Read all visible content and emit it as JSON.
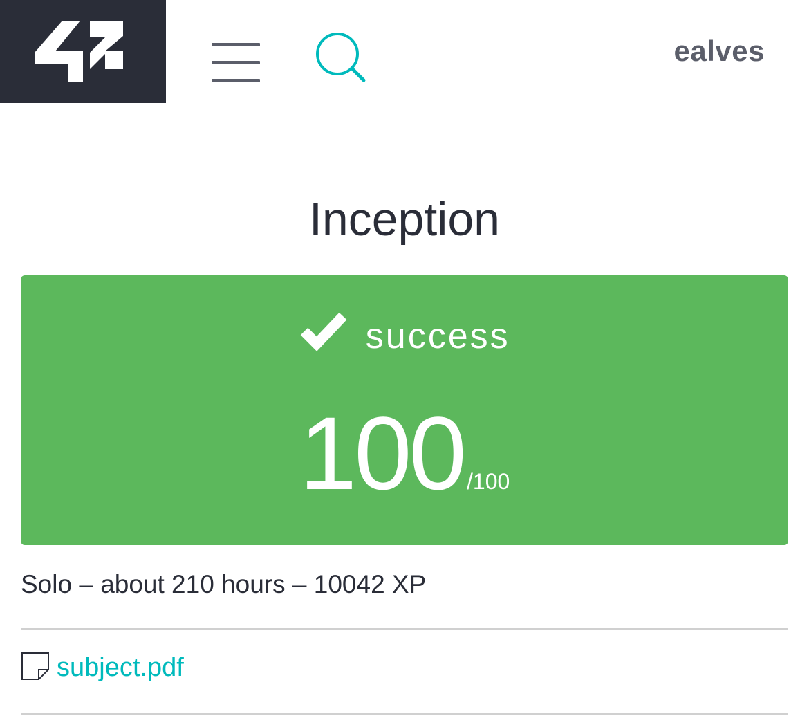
{
  "header": {
    "logo_text": "42",
    "username": "ealves"
  },
  "project": {
    "title": "Inception"
  },
  "result": {
    "status": "success",
    "score": "100",
    "max_score": "/100"
  },
  "meta": "Solo – about 210 hours – 10042 XP",
  "attachment": {
    "label": "subject.pdf",
    "icon": "document-icon"
  },
  "colors": {
    "logo_bg": "#2a2d38",
    "success": "#5cb85c",
    "accent": "#00babc",
    "text_dark": "#2a2d38",
    "text_muted": "#5b5e6a"
  }
}
